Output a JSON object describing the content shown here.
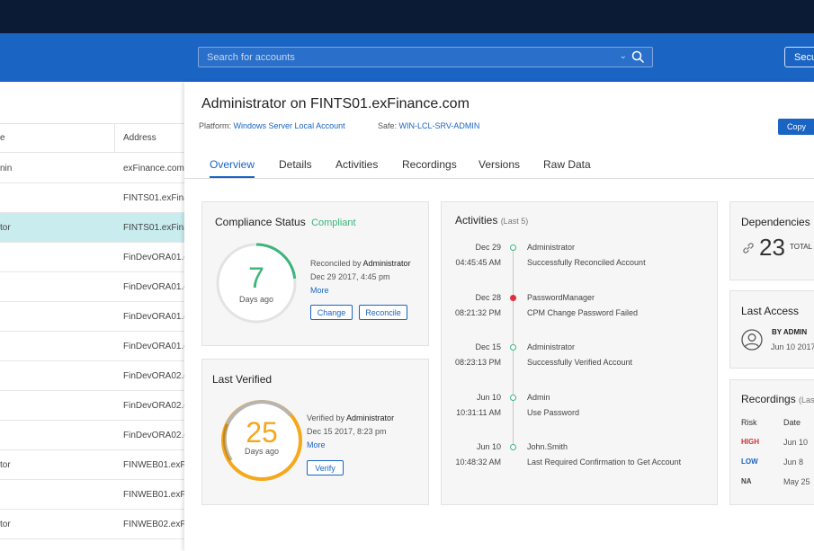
{
  "search": {
    "placeholder": "Search for accounts"
  },
  "header": {
    "secondary_label": "Secu"
  },
  "list": {
    "headers": [
      "e",
      "Address"
    ],
    "rows": [
      [
        "nin",
        "exFinance.com"
      ],
      [
        "",
        "FINTS01.exFinan"
      ],
      [
        "tor",
        "FINTS01.exFinan"
      ],
      [
        "",
        "FinDevORA01.e"
      ],
      [
        "",
        "FinDevORA01.e"
      ],
      [
        "",
        "FinDevORA01.e"
      ],
      [
        "",
        "FinDevORA01.e"
      ],
      [
        "",
        "FinDevORA02.e"
      ],
      [
        "",
        "FinDevORA02.e"
      ],
      [
        "",
        "FinDevORA02.e"
      ],
      [
        "tor",
        "FINWEB01.exFir"
      ],
      [
        "",
        "FINWEB01.exFir"
      ],
      [
        "tor",
        "FINWEB02.exFir"
      ]
    ],
    "selected_index": 2
  },
  "account": {
    "title": "Administrator on FINTS01.exFinance.com",
    "platform_label": "Platform:",
    "platform_value": "Windows Server Local Account",
    "safe_label": "Safe:",
    "safe_value": "WIN-LCL-SRV-ADMIN",
    "copy_label": "Copy"
  },
  "tabs": [
    "Overview",
    "Details",
    "Activities",
    "Recordings",
    "Versions",
    "Raw Data"
  ],
  "compliance": {
    "title": "Compliance Status",
    "status": "Compliant",
    "days": "7",
    "days_label": "Days ago",
    "reconciled_by_prefix": "Reconciled by",
    "reconciled_by": "Administrator",
    "date": "Dec 29 2017, 4:45 pm",
    "more": "More",
    "change_label": "Change",
    "reconcile_label": "Reconcile",
    "ring_fraction": 0.23,
    "ring_color": "#3bb57a"
  },
  "verified": {
    "title": "Last Verified",
    "days": "25",
    "days_label": "Days ago",
    "verified_by_prefix": "Verified by",
    "verified_by": "Administrator",
    "date": "Dec 15 2017, 8:23 pm",
    "more": "More",
    "verify_label": "Verify",
    "ring_color": "#f5a81c"
  },
  "activities": {
    "title": "Activities",
    "subtitle": "(Last 5)",
    "items": [
      {
        "date": "Dec 29",
        "time": "04:45:45 AM",
        "user": "Administrator",
        "message": "Successfully Reconciled Account",
        "status": "ok"
      },
      {
        "date": "Dec 28",
        "time": "08:21:32 PM",
        "user": "PasswordManager",
        "message": "CPM Change Password Failed",
        "status": "fail"
      },
      {
        "date": "Dec 15",
        "time": "08:23:13 PM",
        "user": "Administrator",
        "message": "Successfully Verified Account",
        "status": "ok"
      },
      {
        "date": "Jun 10",
        "time": "10:31:11 AM",
        "user": "Admin",
        "message": "Use Password",
        "status": "ok"
      },
      {
        "date": "Jun 10",
        "time": "10:48:32 AM",
        "user": "John.Smith",
        "message": "Last Required Confirmation to Get Account",
        "status": "ok"
      }
    ]
  },
  "dependencies": {
    "title": "Dependencies",
    "count": "23",
    "total_label": "TOTAL"
  },
  "last_access": {
    "title": "Last Access",
    "by": "BY ADMIN",
    "date": "Jun 10 2017"
  },
  "recordings": {
    "title": "Recordings",
    "subtitle": "(Las",
    "risk_header": "Risk",
    "date_header": "Date",
    "rows": [
      {
        "risk": "HIGH",
        "date": "Jun 10",
        "color": "#d0303d"
      },
      {
        "risk": "LOW",
        "date": "Jun 8",
        "color": "#1a64c4"
      },
      {
        "risk": "NA",
        "date": "May 25",
        "color": "#444444"
      }
    ]
  }
}
